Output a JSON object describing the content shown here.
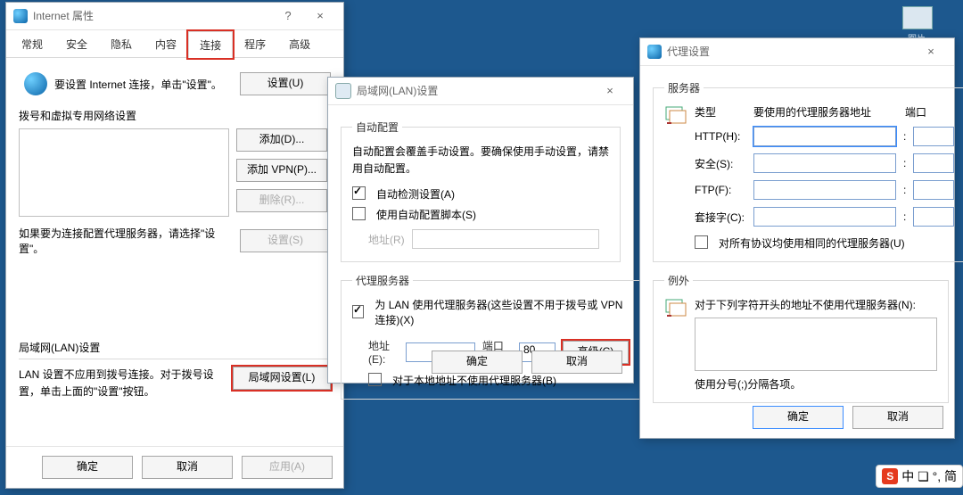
{
  "desktop": {
    "icon_caption": "图片"
  },
  "internet": {
    "title": "Internet 属性",
    "tabs": [
      "常规",
      "安全",
      "隐私",
      "内容",
      "连接",
      "程序",
      "高级"
    ],
    "selected_tab_index": 4,
    "setup_text": "要设置 Internet 连接，单击\"设置\"。",
    "setup_btn": "设置(U)",
    "dial_legend": "拨号和虚拟专用网络设置",
    "btn_add": "添加(D)...",
    "btn_addvpn": "添加 VPN(P)...",
    "btn_del": "删除(R)...",
    "btn_set": "设置(S)",
    "dial_note": "如果要为连接配置代理服务器，请选择\"设置\"。",
    "lan_legend": "局域网(LAN)设置",
    "lan_note": "LAN 设置不应用到拨号连接。对于拨号设置，单击上面的\"设置\"按钮。",
    "btn_lan": "局域网设置(L)",
    "ok": "确定",
    "cancel": "取消",
    "apply": "应用(A)"
  },
  "lan": {
    "title": "局域网(LAN)设置",
    "auto_legend": "自动配置",
    "auto_note": "自动配置会覆盖手动设置。要确保使用手动设置，请禁用自动配置。",
    "auto_detect": "自动检测设置(A)",
    "auto_script": "使用自动配置脚本(S)",
    "addr_label": "地址(R)",
    "proxy_legend": "代理服务器",
    "use_proxy": "为 LAN 使用代理服务器(这些设置不用于拨号或 VPN 连接)(X)",
    "addr_e": "地址(E):",
    "port_t": "端口(T):",
    "port_val": "80",
    "adv": "高级(C)",
    "bypass_local": "对于本地地址不使用代理服务器(B)",
    "ok": "确定",
    "cancel": "取消"
  },
  "proxy": {
    "title": "代理设置",
    "server_legend": "服务器",
    "col_type": "类型",
    "col_addr": "要使用的代理服务器地址",
    "col_port": "端口",
    "rows": {
      "http": "HTTP(H):",
      "secure": "安全(S):",
      "ftp": "FTP(F):",
      "socks": "套接字(C):"
    },
    "same": "对所有协议均使用相同的代理服务器(U)",
    "ex_legend": "例外",
    "ex_label": "对于下列字符开头的地址不使用代理服务器(N):",
    "ex_note": "使用分号(;)分隔各项。",
    "ok": "确定",
    "cancel": "取消"
  },
  "ime": {
    "badge": "S",
    "text": "中 ❏ °, 简"
  }
}
